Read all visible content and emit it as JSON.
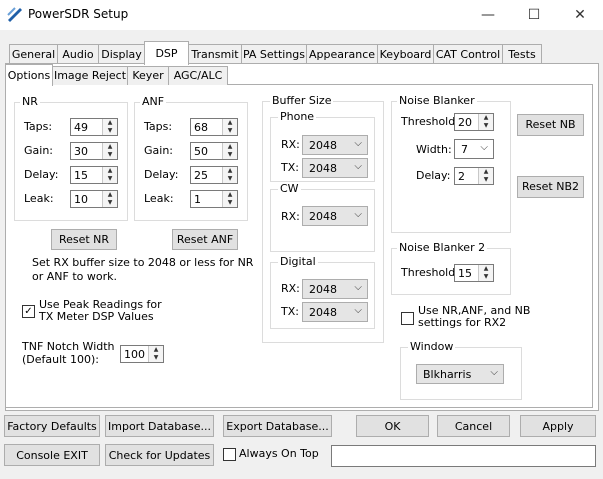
{
  "window": {
    "title": "PowerSDR Setup",
    "minimize": "—",
    "maximize": "☐",
    "close": "✕"
  },
  "tabs": [
    "General",
    "Audio",
    "Display",
    "DSP",
    "Transmit",
    "PA Settings",
    "Appearance",
    "Keyboard",
    "CAT Control",
    "Tests"
  ],
  "subtabs": [
    "Options",
    "Image Reject",
    "Keyer",
    "AGC/ALC"
  ],
  "nr": {
    "legend": "NR",
    "taps_label": "Taps:",
    "taps": "49",
    "gain_label": "Gain:",
    "gain": "30",
    "delay_label": "Delay:",
    "delay": "15",
    "leak_label": "Leak:",
    "leak": "10",
    "reset": "Reset NR"
  },
  "anf": {
    "legend": "ANF",
    "taps_label": "Taps:",
    "taps": "68",
    "gain_label": "Gain:",
    "gain": "50",
    "delay_label": "Delay:",
    "delay": "25",
    "leak_label": "Leak:",
    "leak": "1",
    "reset": "Reset ANF"
  },
  "note": {
    "line1": "Set RX buffer size to 2048 or less for NR",
    "line2": "or ANF to work."
  },
  "peak": {
    "line1": "Use Peak Readings for",
    "line2": "TX Meter DSP Values",
    "checked": "✓"
  },
  "tnf": {
    "line1": "TNF Notch Width",
    "line2": "(Default 100):",
    "value": "100"
  },
  "buffer": {
    "legend": "Buffer Size",
    "phone": {
      "legend": "Phone",
      "rx_label": "RX:",
      "rx": "2048",
      "tx_label": "TX:",
      "tx": "2048"
    },
    "cw": {
      "legend": "CW",
      "rx_label": "RX:",
      "rx": "2048"
    },
    "digital": {
      "legend": "Digital",
      "rx_label": "RX:",
      "rx": "2048",
      "tx_label": "TX:",
      "tx": "2048"
    }
  },
  "nb": {
    "legend": "Noise Blanker",
    "threshold_label": "Threshold:",
    "threshold": "20",
    "width_label": "Width:",
    "width": "7",
    "delay_label": "Delay:",
    "delay": "2",
    "reset": "Reset NB",
    "reset2": "Reset NB2"
  },
  "nb2": {
    "legend": "Noise Blanker 2",
    "threshold_label": "Threshold:",
    "threshold": "15"
  },
  "rx2": {
    "line1": "Use NR,ANF, and NB",
    "line2": "settings for RX2"
  },
  "window_group": {
    "legend": "Window",
    "value": "Blkharris"
  },
  "footer": {
    "factory": "Factory Defaults",
    "import": "Import Database...",
    "export": "Export Database...",
    "ok": "OK",
    "cancel": "Cancel",
    "apply": "Apply",
    "console_exit": "Console EXIT",
    "updates": "Check for Updates",
    "always_on_top": "Always On Top"
  }
}
